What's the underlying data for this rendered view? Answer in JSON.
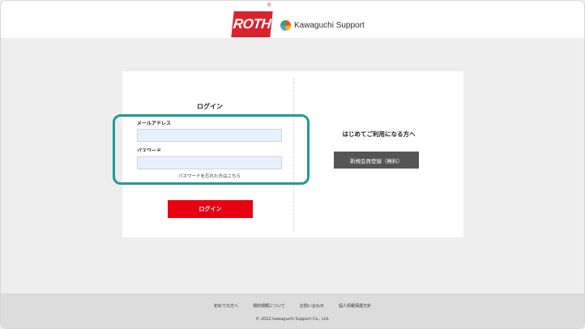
{
  "header": {
    "roth_logo_text": "ROTH",
    "reg_mark": "®",
    "ks_logo_text": "Kawaguchi Support"
  },
  "login": {
    "title": "ログイン",
    "email_label": "メールアドレス",
    "email_value": "",
    "password_label": "パスワード",
    "password_value": "",
    "forgot_link": "パスワードを忘れた方はこちら",
    "login_button": "ログイン"
  },
  "register": {
    "heading": "はじめてご利用になる方へ",
    "button": "新規会員登録（無料）"
  },
  "footer": {
    "links": [
      "初めての方へ",
      "規約規概について",
      "お問い合わせ",
      "個人情報保護方針"
    ],
    "copyright": "© 2022 kawaguchi Support Co., Ltd."
  },
  "colors": {
    "accent_red": "#e50012",
    "highlight_teal": "#1f9b96",
    "register_gray": "#555555"
  }
}
